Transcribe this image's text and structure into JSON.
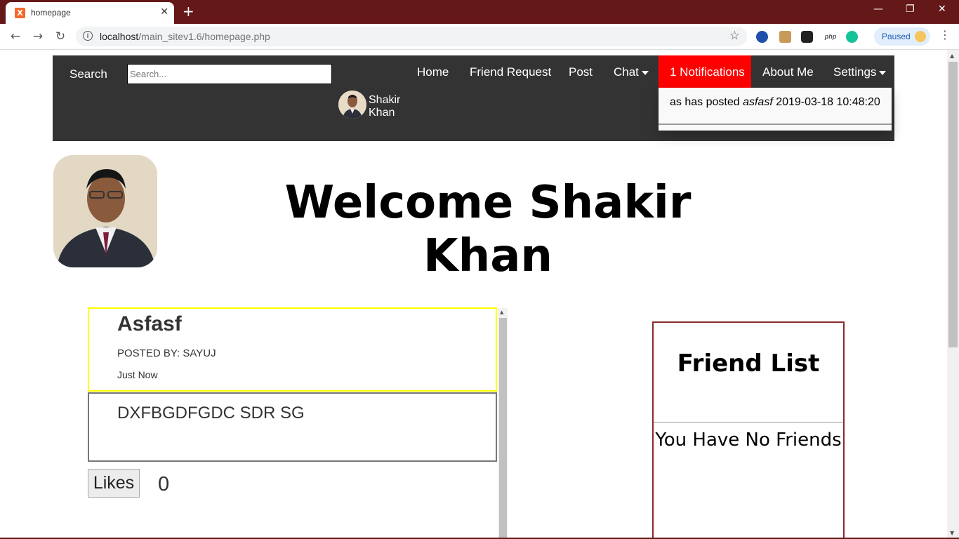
{
  "browser": {
    "tab_title": "homepage",
    "tab_favicon": "X",
    "url_host": "localhost",
    "url_path": "/main_sitev1.6/homepage.php",
    "paused_label": "Paused",
    "ext_php": "php",
    "colors": {
      "titlebar": "#651818",
      "paused_bg": "#e3eefc"
    }
  },
  "navbar": {
    "search_label": "Search",
    "search_placeholder": "Search...",
    "links": {
      "home": "Home",
      "friend_request": "Friend Request",
      "post": "Post",
      "chat": "Chat",
      "notifications": "1 Notifications",
      "about": "About Me",
      "settings": "Settings"
    },
    "user_first": "Shakir",
    "user_last": "Khan",
    "notif_color": "#ff0000"
  },
  "notification_dropdown": {
    "prefix": "as has posted ",
    "post_title": "asfasf",
    "timestamp": " 2019-03-18 10:48:20"
  },
  "welcome": {
    "line1": "Welcome Shakir",
    "line2": "Khan"
  },
  "post": {
    "title": "Asfasf",
    "posted_by": "POSTED BY: SAYUJ",
    "time": "Just Now",
    "body": "DXFBGDFGDC SDR SG",
    "likes_label": "Likes",
    "likes_count": "0"
  },
  "friends": {
    "title": "Friend List",
    "empty_message": "You Have No Friends"
  }
}
